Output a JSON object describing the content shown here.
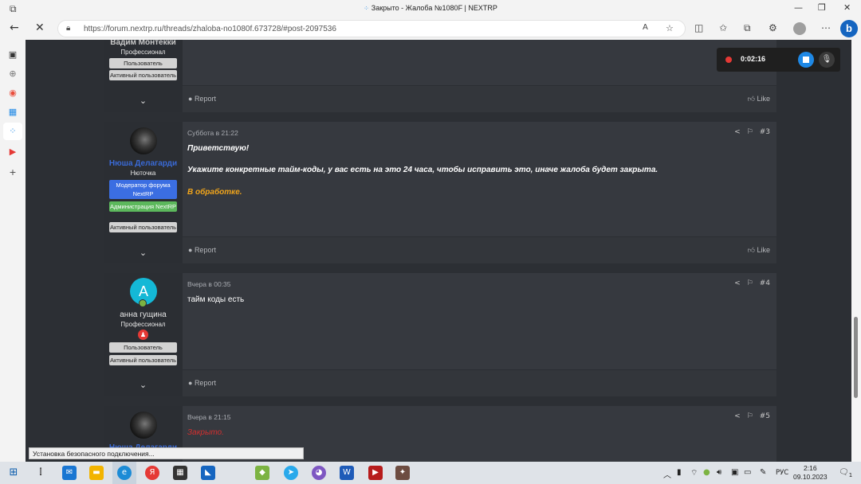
{
  "browser": {
    "tab_title": "Закрыто - Жалоба №1080F | NEXTRP",
    "url": "https://forum.nextrp.ru/threads/zhaloba-no1080f.673728/#post-2097536",
    "reader_icon": "A",
    "status_text": "Установка безопасного подключения..."
  },
  "recorder": {
    "time": "0:02:16"
  },
  "posts": [
    {
      "user": {
        "name": "Вадим Монтекки",
        "title": "Профессионал",
        "badges": [
          "Пользователь",
          "Активный пользователь"
        ]
      },
      "footer": {
        "report": "Report",
        "like": "Like"
      }
    },
    {
      "date": "Суббота в 21:22",
      "number": "#3",
      "user": {
        "name": "Нюша Делагарди",
        "title": "Нюточка",
        "badges": [
          "Модератор форума NextRP",
          "Администрация NextRP",
          "Активный пользователь"
        ]
      },
      "body": [
        "Приветствую!",
        "Укажите конкретные тайм-коды, у вас есть на это 24 часа, чтобы исправить это, иначе жалоба будет закрыта.",
        "В обработке."
      ],
      "footer": {
        "report": "Report",
        "like": "Like"
      }
    },
    {
      "date": "Вчера в 00:35",
      "number": "#4",
      "user": {
        "avatar_letter": "A",
        "name": "анна гущина",
        "title": "Профессионал",
        "badges": [
          "Пользователь",
          "Активный пользователь"
        ]
      },
      "body": [
        "тайм коды есть"
      ],
      "footer": {
        "report": "Report"
      }
    },
    {
      "date": "Вчера в 21:15",
      "number": "#5",
      "user": {
        "name": "Нюша Делагарди"
      },
      "body": [
        "Закрыто."
      ]
    }
  ],
  "taskbar": {
    "lang": "РУС",
    "time": "2:16",
    "date": "09.10.2023",
    "notifications": "1"
  }
}
